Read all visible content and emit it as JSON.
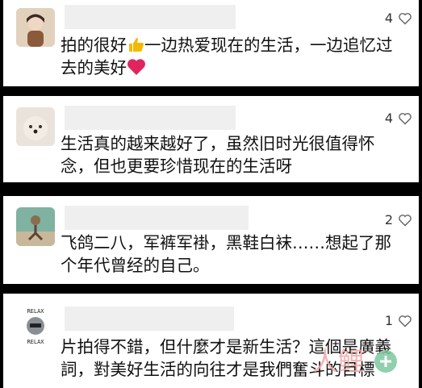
{
  "comments": [
    {
      "likes": "4",
      "text_a": "拍的很好",
      "text_b": "一边热爱现在的生活，一边追忆过去的美好",
      "avatar": "avatar-girl-icon"
    },
    {
      "likes": "4",
      "text": "生活真的越来越好了，虽然旧时光很值得怀念，但也更要珍惜现在的生活呀",
      "avatar": "avatar-dog-icon"
    },
    {
      "likes": "2",
      "text": "飞鸽二八，军裤军褂，黑鞋白袜……想起了那个年代曾经的自己。",
      "avatar": "avatar-bicycle-icon"
    },
    {
      "likes": "1",
      "text": "片拍得不錯，但什麼才是新生活？這個是廣義詞，對美好生活的向往才是我們奮斗的目標",
      "avatar": "avatar-relax-icon",
      "avatar_caption_top": "RELAX",
      "avatar_caption_bottom": "RELAX"
    }
  ],
  "watermark": {
    "text": "人鲤"
  },
  "colors": {
    "placeholder": "#efefef",
    "heart": "#e0245e",
    "thumb": "#f5b800"
  }
}
